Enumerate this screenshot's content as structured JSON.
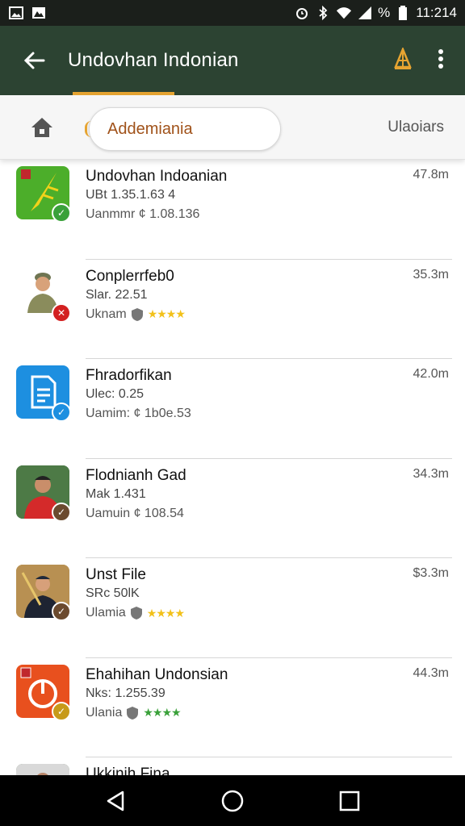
{
  "status_bar": {
    "time": "11:214",
    "battery": "%",
    "icons": [
      "gallery-icon",
      "image-icon",
      "alarm-icon",
      "bluetooth-icon",
      "wifi-icon",
      "signal-icon",
      "battery-icon"
    ]
  },
  "app_bar": {
    "title": "Undovhan Indonian",
    "icons": [
      "back-arrow-icon",
      "signal-tower-icon",
      "overflow-menu-icon"
    ]
  },
  "filter_bar": {
    "chip_label": "Addemiania",
    "right_label": "Ulaoiars",
    "icons": [
      "home-icon"
    ]
  },
  "apps": [
    {
      "name": "Undovhan Indoanian",
      "line2": "UBt 1.35.1.63 4",
      "line3": "Uanmmr ¢ 1.08.136",
      "size": "47.8m",
      "icon": "green-rocket-icon",
      "badge": "check-badge-icon",
      "badge_color": "#3aa13a",
      "rating": null
    },
    {
      "name": "Conplerrfeb0",
      "line2": "Slar. 22.51",
      "line3": "Uknam",
      "size": "35.3m",
      "icon": "soldier-avatar-icon",
      "badge": "remove-badge-icon",
      "badge_color": "#d32020",
      "rating": "★★★★"
    },
    {
      "name": "Fhradorfikan",
      "line2": "Ulec: 0.25",
      "line3": "Uamim: ¢ 1b0e.53",
      "size": "42.0m",
      "icon": "document-icon",
      "badge": "check-badge-icon",
      "badge_color": "#1d8fe0",
      "rating": null
    },
    {
      "name": "Flodnianh Gad",
      "line2": "Mak 1.431",
      "line3": "Uamuin ¢ 108.54",
      "size": "34.3m",
      "icon": "person-photo-icon",
      "badge": "check-badge-icon",
      "badge_color": "#6b4a2e",
      "rating": null
    },
    {
      "name": "Unst File",
      "line2": "SRc 50lK",
      "line3": "Ulamia",
      "size": "$3.3m",
      "icon": "person-sunset-icon",
      "badge": "check-badge-icon",
      "badge_color": "#6b4a2e",
      "rating": "★★★★"
    },
    {
      "name": "Ehahihan Undonsian",
      "line2": "Nks: 1.255.39",
      "line3": "Ulania",
      "size": "44.3m",
      "icon": "power-button-icon",
      "badge": "check-badge-icon",
      "badge_color": "#c79a1a",
      "rating": "★★★★"
    },
    {
      "name": "Ukkinih Fina",
      "line2": "",
      "line3": "",
      "size": "",
      "icon": "person-photo-icon",
      "badge": "",
      "badge_color": "#6b4a2e",
      "rating": null
    }
  ],
  "colors": {
    "app_bar": "#2c4332",
    "accent": "#e6a431",
    "status_bar": "#1b1f1b"
  },
  "nav_bar": {
    "icons": [
      "back-triangle-icon",
      "home-circle-icon",
      "recents-square-icon"
    ]
  }
}
